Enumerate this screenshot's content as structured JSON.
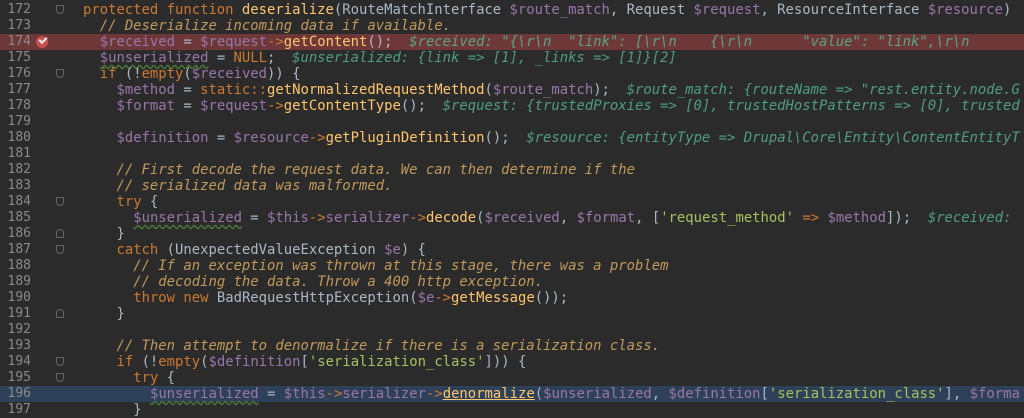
{
  "editor": {
    "colors": {
      "background": "#2b2b2b",
      "breakpoint_line": "#6f3838",
      "execution_line": "#2f4158",
      "keyword": "#cc7832",
      "variable": "#9876aa",
      "function": "#ffc66d",
      "comment": "#c0995c",
      "string": "#a5c261",
      "debug_value": "#4f9c80"
    },
    "lines": [
      {
        "num": "172",
        "fold": "start",
        "indent": 0,
        "tokens": [
          [
            "k",
            "protected function "
          ],
          [
            "f",
            "deserialize"
          ],
          [
            "p",
            "(RouteMatchInterface "
          ],
          [
            "v",
            "$route_match"
          ],
          [
            "p",
            ", Request "
          ],
          [
            "v",
            "$request"
          ],
          [
            "p",
            ", ResourceInterface "
          ],
          [
            "v",
            "$resource"
          ],
          [
            "p",
            ")"
          ]
        ]
      },
      {
        "num": "173",
        "indent": 2,
        "tokens": [
          [
            "c",
            "// Deserialize incoming data if available."
          ]
        ]
      },
      {
        "num": "174",
        "indent": 2,
        "breakpoint": true,
        "tokens": [
          [
            "v",
            "$received"
          ],
          [
            "p",
            " = "
          ],
          [
            "v",
            "$request"
          ],
          [
            "k",
            "->"
          ],
          [
            "f",
            "getContent"
          ],
          [
            "p",
            "();  "
          ],
          [
            "d",
            "$received: \"{\\r\\n  \"link\": [\\r\\n    {\\r\\n      \"value\": \"link\",\\r\\n"
          ]
        ]
      },
      {
        "num": "175",
        "indent": 2,
        "tokens": [
          [
            "vw",
            "$unserialized"
          ],
          [
            "p",
            " = "
          ],
          [
            "k",
            "NULL"
          ],
          [
            "p",
            ";  "
          ],
          [
            "d",
            "$unserialized: {link => [1], _links => [1]}[2]"
          ]
        ]
      },
      {
        "num": "176",
        "fold": "start",
        "indent": 2,
        "tokens": [
          [
            "k",
            "if "
          ],
          [
            "p",
            "(!"
          ],
          [
            "k",
            "empty"
          ],
          [
            "p",
            "("
          ],
          [
            "v",
            "$received"
          ],
          [
            "p",
            ")) {"
          ]
        ]
      },
      {
        "num": "177",
        "indent": 4,
        "tokens": [
          [
            "v",
            "$method"
          ],
          [
            "p",
            " = "
          ],
          [
            "k",
            "static::"
          ],
          [
            "f",
            "getNormalizedRequestMethod"
          ],
          [
            "p",
            "("
          ],
          [
            "v",
            "$route_match"
          ],
          [
            "p",
            ");  "
          ],
          [
            "d",
            "$route_match: {routeName => \"rest.entity.node.G"
          ]
        ]
      },
      {
        "num": "178",
        "indent": 4,
        "tokens": [
          [
            "v",
            "$format"
          ],
          [
            "p",
            " = "
          ],
          [
            "v",
            "$request"
          ],
          [
            "k",
            "->"
          ],
          [
            "f",
            "getContentType"
          ],
          [
            "p",
            "();  "
          ],
          [
            "d",
            "$request: {trustedProxies => [0], trustedHostPatterns => [0], trusted"
          ]
        ]
      },
      {
        "num": "179",
        "indent": 0,
        "tokens": []
      },
      {
        "num": "180",
        "indent": 4,
        "tokens": [
          [
            "v",
            "$definition"
          ],
          [
            "p",
            " = "
          ],
          [
            "v",
            "$resource"
          ],
          [
            "k",
            "->"
          ],
          [
            "f",
            "getPluginDefinition"
          ],
          [
            "p",
            "();  "
          ],
          [
            "d",
            "$resource: {entityType => Drupal\\Core\\Entity\\ContentEntityT"
          ]
        ]
      },
      {
        "num": "181",
        "indent": 0,
        "tokens": []
      },
      {
        "num": "182",
        "indent": 4,
        "tokens": [
          [
            "c",
            "// First decode the request data. We can then determine if the"
          ]
        ]
      },
      {
        "num": "183",
        "indent": 4,
        "tokens": [
          [
            "c",
            "// serialized data was malformed."
          ]
        ]
      },
      {
        "num": "184",
        "fold": "start",
        "indent": 4,
        "tokens": [
          [
            "k",
            "try "
          ],
          [
            "p",
            "{"
          ]
        ]
      },
      {
        "num": "185",
        "indent": 6,
        "tokens": [
          [
            "vw",
            "$unserialized"
          ],
          [
            "p",
            " = "
          ],
          [
            "v",
            "$this"
          ],
          [
            "k",
            "->"
          ],
          [
            "v",
            "serializer"
          ],
          [
            "k",
            "->"
          ],
          [
            "f",
            "decode"
          ],
          [
            "p",
            "("
          ],
          [
            "v",
            "$received"
          ],
          [
            "p",
            ", "
          ],
          [
            "v",
            "$format"
          ],
          [
            "p",
            ", ["
          ],
          [
            "s",
            "'request_method'"
          ],
          [
            "k",
            " => "
          ],
          [
            "v",
            "$method"
          ],
          [
            "p",
            "]);  "
          ],
          [
            "d",
            "$received: "
          ]
        ]
      },
      {
        "num": "186",
        "fold": "end",
        "indent": 4,
        "tokens": [
          [
            "p",
            "}"
          ]
        ]
      },
      {
        "num": "187",
        "fold": "start",
        "indent": 4,
        "tokens": [
          [
            "k",
            "catch "
          ],
          [
            "p",
            "(UnexpectedValueException "
          ],
          [
            "v",
            "$e"
          ],
          [
            "p",
            ") {"
          ]
        ]
      },
      {
        "num": "188",
        "indent": 6,
        "tokens": [
          [
            "c",
            "// If an exception was thrown at this stage, there was a problem"
          ]
        ]
      },
      {
        "num": "189",
        "indent": 6,
        "tokens": [
          [
            "c",
            "// decoding the data. Throw a 400 http exception."
          ]
        ]
      },
      {
        "num": "190",
        "indent": 6,
        "tokens": [
          [
            "k",
            "throw new "
          ],
          [
            "p",
            "BadRequestHttpException("
          ],
          [
            "v",
            "$e"
          ],
          [
            "k",
            "->"
          ],
          [
            "f",
            "getMessage"
          ],
          [
            "p",
            "());"
          ]
        ]
      },
      {
        "num": "191",
        "fold": "end",
        "indent": 4,
        "tokens": [
          [
            "p",
            "}"
          ]
        ]
      },
      {
        "num": "192",
        "indent": 0,
        "tokens": []
      },
      {
        "num": "193",
        "indent": 4,
        "tokens": [
          [
            "c",
            "// Then attempt to denormalize if there is a serialization class."
          ]
        ]
      },
      {
        "num": "194",
        "fold": "start",
        "indent": 4,
        "tokens": [
          [
            "k",
            "if "
          ],
          [
            "p",
            "(!"
          ],
          [
            "k",
            "empty"
          ],
          [
            "p",
            "("
          ],
          [
            "v",
            "$definition"
          ],
          [
            "p",
            "["
          ],
          [
            "s",
            "'serialization_class'"
          ],
          [
            "p",
            "])) {"
          ]
        ]
      },
      {
        "num": "195",
        "fold": "start",
        "indent": 6,
        "tokens": [
          [
            "k",
            "try "
          ],
          [
            "p",
            "{"
          ]
        ]
      },
      {
        "num": "196",
        "indent": 8,
        "exec": true,
        "tokens": [
          [
            "vw",
            "$unserialized"
          ],
          [
            "p",
            " = "
          ],
          [
            "v",
            "$this"
          ],
          [
            "k",
            "->"
          ],
          [
            "v",
            "serializer"
          ],
          [
            "k",
            "->"
          ],
          [
            "u",
            "denormalize"
          ],
          [
            "p",
            "("
          ],
          [
            "v",
            "$unserialized"
          ],
          [
            "p",
            ", "
          ],
          [
            "v",
            "$definition"
          ],
          [
            "p",
            "["
          ],
          [
            "s",
            "'serialization_class'"
          ],
          [
            "p",
            "], "
          ],
          [
            "v",
            "$forma"
          ]
        ]
      },
      {
        "num": "197",
        "indent": 6,
        "tokens": [
          [
            "p",
            "}"
          ]
        ]
      }
    ]
  }
}
